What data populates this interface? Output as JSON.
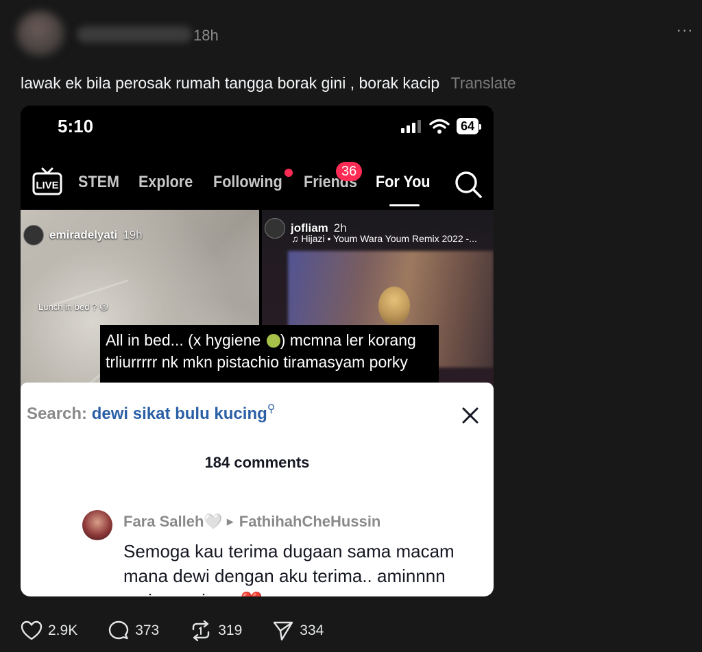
{
  "post": {
    "timestamp": "18h",
    "more_label": "···",
    "caption": "lawak ek bila perosak rumah tangga borak gini , borak kacip",
    "translate_label": "Translate"
  },
  "embedded": {
    "status_bar": {
      "time": "5:10",
      "battery": "64"
    },
    "nav": {
      "live_label": "LIVE",
      "tabs": [
        "STEM",
        "Explore",
        "Following",
        "Friends",
        "For You"
      ],
      "active_tab": "For You",
      "friends_badge": "36"
    },
    "left_tile": {
      "username": "emiradelyati",
      "time": "19h",
      "caption": "Lunch in bed ? 😅"
    },
    "right_tile": {
      "username": "jofliam",
      "time": "2h",
      "music": "Hijazi • Youm Wara Youm Remix 2022 -..."
    },
    "overlay": {
      "line1": "All in bed... (x hygiene",
      "line1_end": ") mcmna ler korang",
      "line2": "trliurrrrr nk mkn pistachio tiramasyam porky"
    },
    "comments_sheet": {
      "search_prefix": "Search:",
      "search_term": "dewi sikat bulu kucing",
      "count_label": "184 comments",
      "comment": {
        "author": "Fara Salleh🤍",
        "reply_to": "FathihahCheHussin",
        "text": "Semoga kau terima dugaan sama macam mana dewi dengan aku terima.. aminnnn aminn aminnn ❤️"
      }
    }
  },
  "actions": {
    "likes": "2.9K",
    "comments": "373",
    "reposts": "319",
    "shares": "334"
  }
}
